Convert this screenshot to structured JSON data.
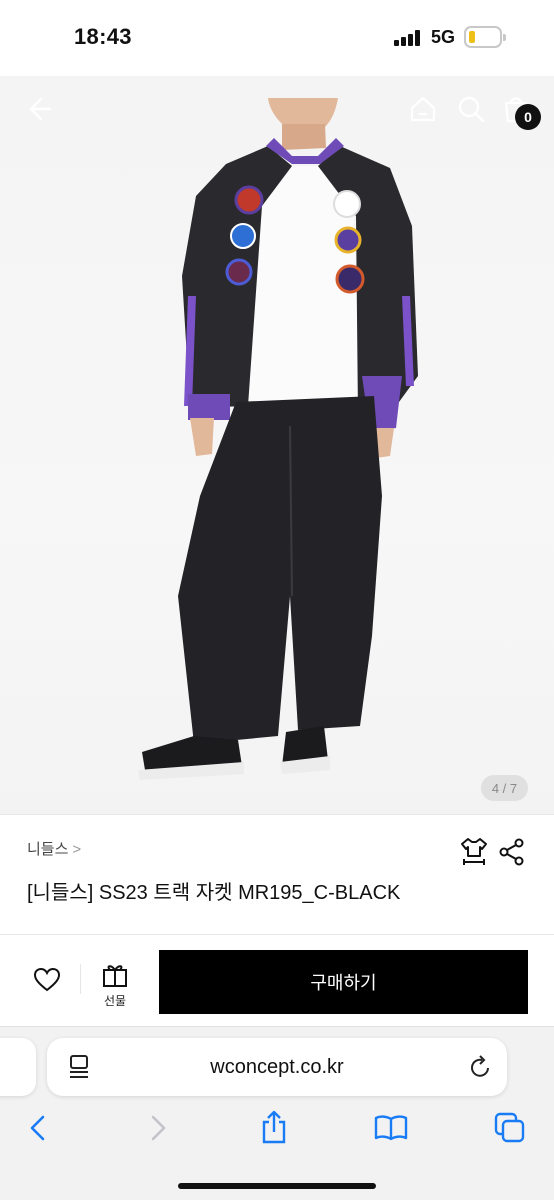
{
  "status": {
    "time": "18:43",
    "network": "5G"
  },
  "cart": {
    "count": "0"
  },
  "gallery": {
    "indicator": "4 / 7"
  },
  "product": {
    "brand": "니들스",
    "brand_chevron": ">",
    "title": "[니들스] SS23 트랙 자켓 MR195_C-BLACK"
  },
  "actions": {
    "gift_label": "선물",
    "buy_label": "구매하기"
  },
  "browser": {
    "url": "wconcept.co.kr"
  },
  "colors": {
    "accent": "#000000",
    "battery": "#f0c01a",
    "ios_blue": "#1a7cf5"
  },
  "icons": [
    "back-arrow-icon",
    "home-icon",
    "search-icon",
    "cart-icon",
    "size-guide-icon",
    "share-icon",
    "heart-icon",
    "gift-icon",
    "reader-icon",
    "reload-icon",
    "safari-back-icon",
    "safari-forward-icon",
    "share-sheet-icon",
    "bookmarks-icon",
    "tabs-icon"
  ]
}
